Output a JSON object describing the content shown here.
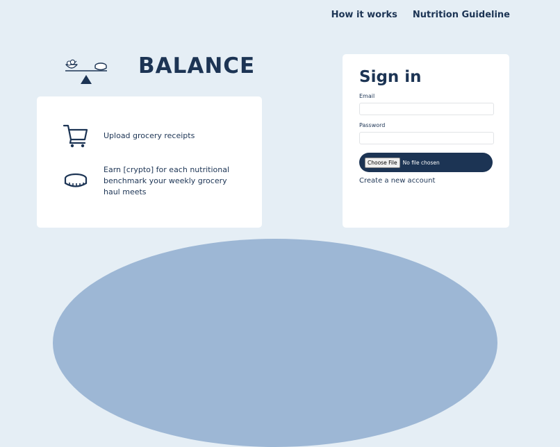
{
  "nav": {
    "how_it_works": "How it works",
    "nutrition_guideline": "Nutrition Guideline"
  },
  "brand": {
    "title": "BALANCE",
    "logo_icon": "balance-scale-icon"
  },
  "features": [
    {
      "icon": "shopping-cart-icon",
      "text": "Upload grocery receipts"
    },
    {
      "icon": "coin-icon",
      "text": "Earn [crypto] for each nutritional benchmark your weekly grocery haul meets"
    }
  ],
  "signin": {
    "title": "Sign in",
    "email_label": "Email",
    "email_value": "",
    "password_label": "Password",
    "password_value": "",
    "file_button_label": "Choose File",
    "file_status": "No file chosen",
    "create_account_link": "Create a new account"
  },
  "colors": {
    "background": "#e5eef5",
    "primary": "#1c3454",
    "card": "#ffffff",
    "hill": "#9db7d5"
  }
}
